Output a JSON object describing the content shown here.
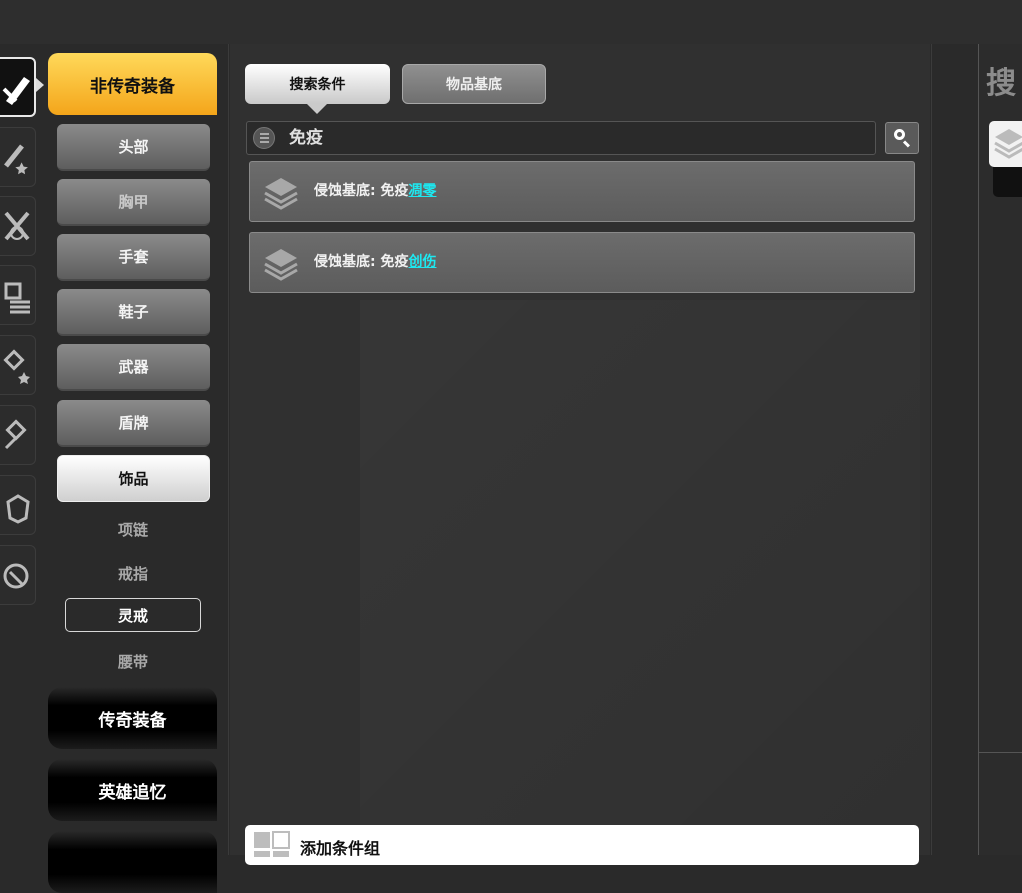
{
  "sidebar": {
    "header": "非传奇装备",
    "sub_buttons": [
      {
        "label": "头部"
      },
      {
        "label": "胸甲"
      },
      {
        "label": "手套"
      },
      {
        "label": "鞋子"
      },
      {
        "label": "武器"
      },
      {
        "label": "盾牌"
      },
      {
        "label": "饰品"
      }
    ],
    "sub_items": [
      {
        "label": "项链"
      },
      {
        "label": "戒指"
      },
      {
        "label": "灵戒"
      },
      {
        "label": "腰带"
      }
    ],
    "sections": [
      {
        "label": "传奇装备"
      },
      {
        "label": "英雄追忆"
      }
    ]
  },
  "tabs": [
    {
      "label": "搜索条件",
      "active": true
    },
    {
      "label": "物品基底",
      "active": false
    }
  ],
  "search": {
    "value": "免疫"
  },
  "results": [
    {
      "prefix": "侵蚀基底: 免疫",
      "link": "凋零"
    },
    {
      "prefix": "侵蚀基底: 免疫",
      "link": "创伤"
    }
  ],
  "footer": {
    "add_group": "添加条件组"
  },
  "right_panel": {
    "title": "搜"
  },
  "colors": {
    "accent": "#f4a51a",
    "link": "#1de8f0"
  }
}
